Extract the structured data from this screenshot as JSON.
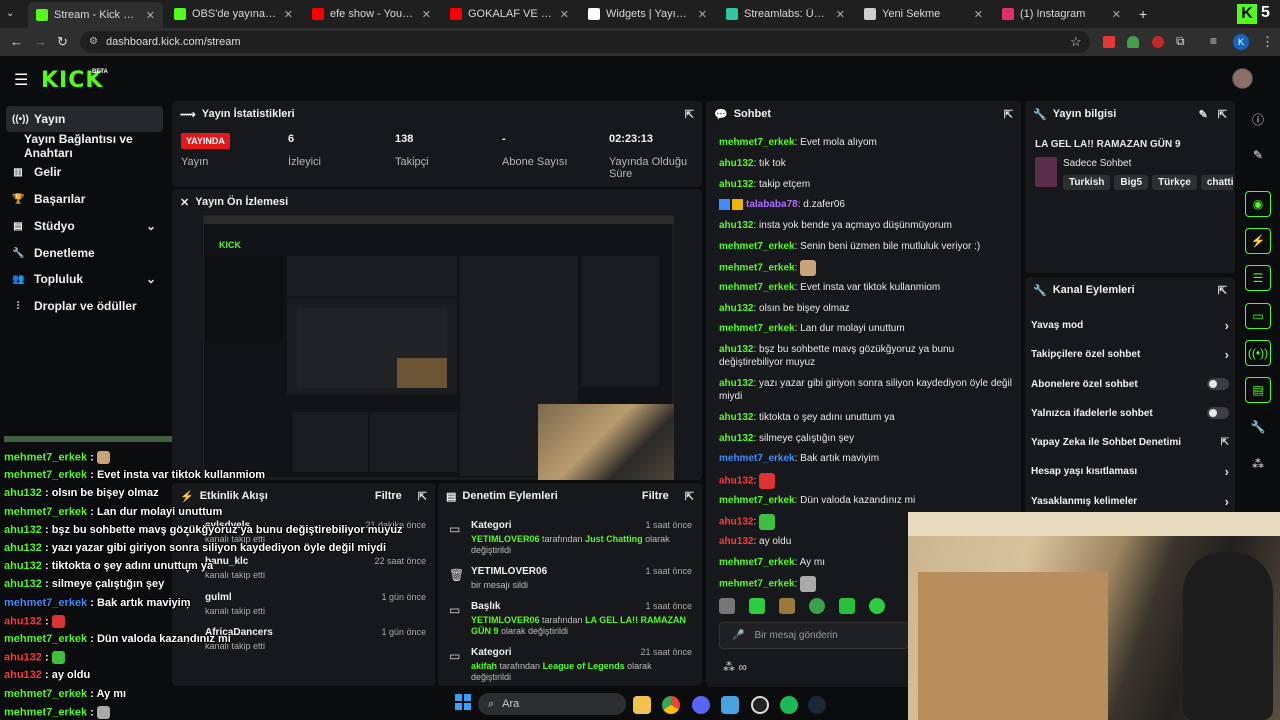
{
  "browser": {
    "tabs": [
      {
        "label": "Stream - Kick Dashboard",
        "color": "#53fc18",
        "active": true
      },
      {
        "label": "OBS'de yayına chat ekran",
        "color": "#53fc18"
      },
      {
        "label": "efe show - YouTube",
        "color": "#ff0000"
      },
      {
        "label": "GOKALAF VE PANKY İLE I",
        "color": "#ff0000"
      },
      {
        "label": "Widgets | Yayınını güçlen",
        "color": "#ffffff"
      },
      {
        "label": "Streamlabs: Ücretsiz Canl",
        "color": "#31c3a2"
      },
      {
        "label": "Yeni Sekme",
        "color": "#cfcfcf"
      },
      {
        "label": "(1) Instagram",
        "color": "#e1306c"
      }
    ],
    "url": "dashboard.kick.com/stream",
    "profile_initial": "K"
  },
  "brand": {
    "logo": "KICK",
    "beta": "BETA",
    "accent": "#53fc18"
  },
  "sidebar": {
    "items": [
      {
        "label": "Yayın",
        "icon": "broadcast-icon"
      },
      {
        "label": "Yayın Bağlantısı ve Anahtarı"
      },
      {
        "label": "Gelir",
        "icon": "chart-icon"
      },
      {
        "label": "Başarılar",
        "icon": "trophy-icon"
      },
      {
        "label": "Stüdyo",
        "icon": "studio-icon"
      },
      {
        "label": "Denetleme",
        "icon": "wrench-icon"
      },
      {
        "label": "Topluluk",
        "icon": "community-icon"
      },
      {
        "label": "Droplar ve ödüller",
        "icon": "drops-icon"
      }
    ]
  },
  "stats": {
    "title": "Yayın İstatistikleri",
    "badge": "YAYINDA",
    "items": [
      {
        "value": "",
        "label": "Yayın"
      },
      {
        "value": "6",
        "label": "İzleyici"
      },
      {
        "value": "138",
        "label": "Takipçi"
      },
      {
        "value": "-",
        "label": "Abone Sayısı"
      },
      {
        "value": "02:23:13",
        "label": "Yayında Olduğu Süre"
      }
    ]
  },
  "preview": {
    "title": "Yayın Ön İzlemesi"
  },
  "chat": {
    "title": "Sohbet",
    "placeholder": "Bir mesaj gönderin",
    "messages": [
      {
        "user": "mehmet7_erkek",
        "text": "Evet mola alıyom",
        "color": "#53fc18"
      },
      {
        "user": "ahu132",
        "text": "tık tok",
        "color": "#53fc18"
      },
      {
        "user": "ahu132",
        "text": "takip etçem",
        "color": "#53fc18"
      },
      {
        "user": "talababa78",
        "text": "d.zafer06",
        "color": "#b36bff"
      },
      {
        "user": "ahu132",
        "text": "insta yok bende ya açmayo düşünmüyorum",
        "color": "#53fc18"
      },
      {
        "user": "mehmet7_erkek",
        "text": "Senin beni üzmen bile mutluluk veriyor :)",
        "color": "#53fc18"
      },
      {
        "user": "mehmet7_erkek",
        "text": "",
        "color": "#53fc18"
      },
      {
        "user": "mehmet7_erkek",
        "text": "Evet insta var tiktok kullanmiom",
        "color": "#53fc18"
      },
      {
        "user": "ahu132",
        "text": "olsın be bişey olmaz",
        "color": "#53fc18"
      },
      {
        "user": "mehmet7_erkek",
        "text": "Lan dur molayi unuttum",
        "color": "#53fc18"
      },
      {
        "user": "ahu132",
        "text": "bşz bu sohbette mavş gözükğyoruz ya bunu değiştirebiliyor muyuz",
        "color": "#53fc18"
      },
      {
        "user": "ahu132",
        "text": "yazı yazar gibi giriyon sonra siliyon kaydediyon öyle değil miydi",
        "color": "#53fc18"
      },
      {
        "user": "ahu132",
        "text": "tiktokta o şey adını unuttum ya",
        "color": "#53fc18"
      },
      {
        "user": "ahu132",
        "text": "silmeye çalıştığın şey",
        "color": "#53fc18"
      },
      {
        "user": "mehmet7_erkek",
        "text": "Bak artık maviyim",
        "color": "#3e8cff"
      },
      {
        "user": "ahu132",
        "text": "",
        "color": "#ff3b3b"
      },
      {
        "user": "mehmet7_erkek",
        "text": "Dün valoda kazandınız mi",
        "color": "#53fc18"
      },
      {
        "user": "ahu132",
        "text": "",
        "color": "#ff3b3b"
      },
      {
        "user": "ahu132",
        "text": "ay oldu",
        "color": "#ff3b3b"
      },
      {
        "user": "mehmet7_erkek",
        "text": "Ay mı",
        "color": "#53fc18"
      },
      {
        "user": "mehmet7_erkek",
        "text": "",
        "color": "#53fc18"
      }
    ]
  },
  "overlay_chat": [
    {
      "user": "mehmet7_erkek",
      "text": "",
      "color": "#53fc18"
    },
    {
      "user": "mehmet7_erkek",
      "text": "Evet insta var tiktok kullanmiom",
      "color": "#53fc18"
    },
    {
      "user": "ahu132",
      "text": "olsın be bişey olmaz",
      "color": "#53fc18"
    },
    {
      "user": "mehmet7_erkek",
      "text": "Lan dur molayi unuttum",
      "color": "#53fc18"
    },
    {
      "user": "ahu132",
      "text": "bşz bu sohbette mavş gözükğyoruz ya bunu değiştirebiliyor muyuz",
      "color": "#53fc18"
    },
    {
      "user": "ahu132",
      "text": "yazı yazar gibi giriyon sonra siliyon kaydediyon öyle değil miydi",
      "color": "#53fc18"
    },
    {
      "user": "ahu132",
      "text": "tiktokta o şey adını unuttum ya",
      "color": "#53fc18"
    },
    {
      "user": "ahu132",
      "text": "silmeye çalıştığın şey",
      "color": "#53fc18"
    },
    {
      "user": "mehmet7_erkek",
      "text": "Bak artık maviyim",
      "color": "#3e8cff"
    },
    {
      "user": "ahu132",
      "text": "",
      "color": "#ff3b3b"
    },
    {
      "user": "mehmet7_erkek",
      "text": "Dün valoda kazandınız mi",
      "color": "#53fc18"
    },
    {
      "user": "ahu132",
      "text": "",
      "color": "#ff3b3b"
    },
    {
      "user": "ahu132",
      "text": "ay oldu",
      "color": "#ff3b3b"
    },
    {
      "user": "mehmet7_erkek",
      "text": "Ay mı",
      "color": "#53fc18"
    },
    {
      "user": "mehmet7_erkek",
      "text": "",
      "color": "#53fc18"
    }
  ],
  "activity": {
    "title": "Etkinlik Akışı",
    "filter": "Filtre",
    "items": [
      {
        "name": "sylsdyels",
        "sub": "kanalı takip etti",
        "time": "21 dakika önce"
      },
      {
        "name": "banu_klc",
        "sub": "kanalı takip etti",
        "time": "22 saat önce"
      },
      {
        "name": "gulml",
        "sub": "kanalı takip etti",
        "time": "1 gün önce"
      },
      {
        "name": "AfricaDancers",
        "sub": "kanalı takip etti",
        "time": "1 gün önce"
      }
    ]
  },
  "moderation": {
    "title": "Denetim Eylemleri",
    "filter": "Filtre",
    "items": [
      {
        "title": "Kategori",
        "user": "YETIMLOVER06",
        "mid": " tarafından ",
        "hl": "Just Chatting",
        "rest": " olarak değiştirildi",
        "time": "1 saat önce"
      },
      {
        "title": "YETIMLOVER06",
        "user": "",
        "mid": "bir mesajı sildi",
        "hl": "",
        "rest": "",
        "time": "1 saat önce"
      },
      {
        "title": "Başlık",
        "user": "YETIMLOVER06",
        "mid": " tarafından ",
        "hl": "LA GEL LA!! RAMAZAN GÜN 9",
        "rest": " olarak değiştirildi",
        "time": "1 saat önce"
      },
      {
        "title": "Kategori",
        "user": "akifah",
        "mid": " tarafından ",
        "hl": "League of Legends",
        "rest": " olarak değiştirildi",
        "time": "21 saat önce"
      }
    ]
  },
  "stream_info": {
    "title": "Yayın bilgisi",
    "stream_title": "LA GEL LA!! RAMAZAN GÜN 9",
    "category": "Sadece Sohbet",
    "tags": [
      "Turkish",
      "Big5",
      "Türkçe",
      "chatti"
    ]
  },
  "channel_actions": {
    "title": "Kanal Eylemleri",
    "items": [
      {
        "label": "Yavaş mod",
        "type": "arrow"
      },
      {
        "label": "Takipçilere özel sohbet",
        "type": "arrow"
      },
      {
        "label": "Abonelere özel sohbet",
        "type": "toggle"
      },
      {
        "label": "Yalnızca ifadelerle sohbet",
        "type": "toggle"
      },
      {
        "label": "Yapay Zeka ile Sohbet Denetimi",
        "type": "external"
      },
      {
        "label": "Hesap yaşı kısıtlaması",
        "type": "arrow"
      },
      {
        "label": "Yasaklanmış kelimeler",
        "type": "arrow"
      }
    ]
  },
  "taskbar": {
    "search": "Ara"
  }
}
